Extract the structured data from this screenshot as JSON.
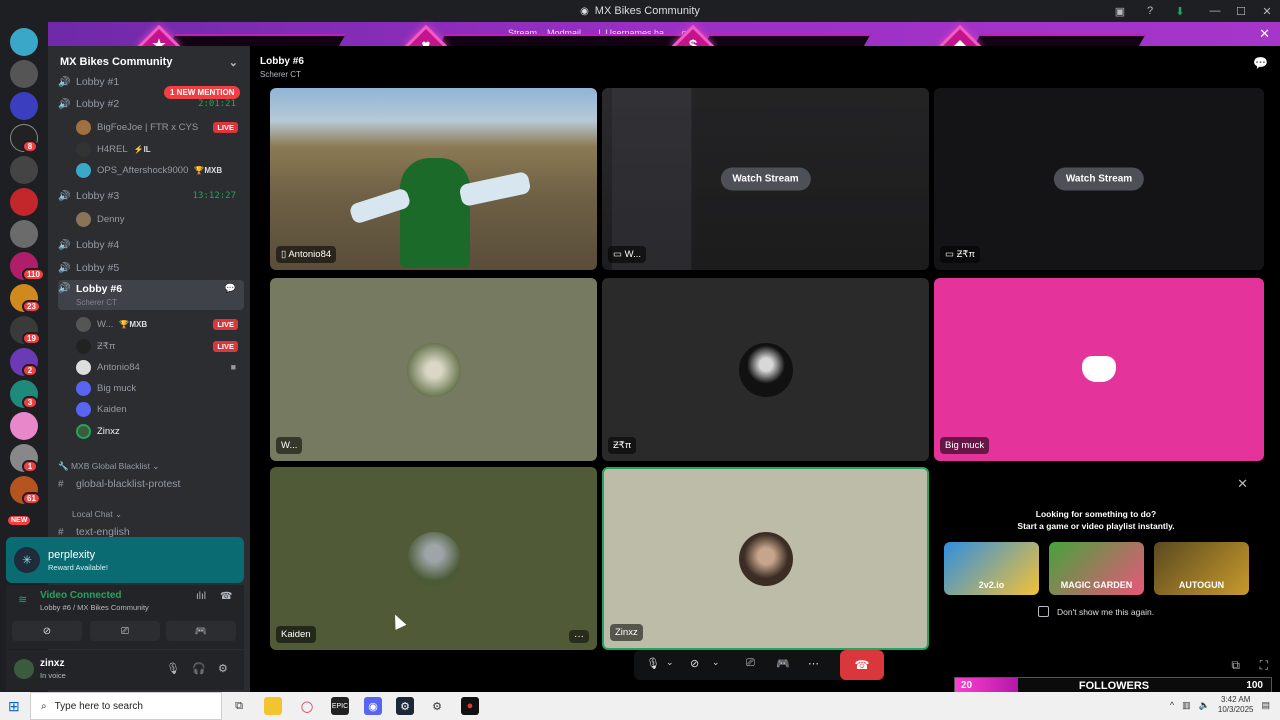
{
  "window": {
    "title": "MX Bikes Community",
    "minimize": "—",
    "maximize": "☐",
    "close": "✕"
  },
  "banner": {
    "text": "Stream... Modmail... ...l. Usernames ha... ...ged.",
    "close": "✕"
  },
  "overlay_symbols": [
    "★",
    "♥",
    "$",
    "◆"
  ],
  "sidebar": {
    "server_name": "MX Bikes Community",
    "mention_badge": "1 NEW MENTION",
    "channels": [
      {
        "name": "Lobby #1",
        "time": ""
      },
      {
        "name": "Lobby #2",
        "time": "2:01:21"
      },
      {
        "name": "Lobby #3",
        "time": "13:12:27"
      },
      {
        "name": "Lobby #4",
        "time": ""
      },
      {
        "name": "Lobby #5",
        "time": ""
      },
      {
        "name": "Lobby #6",
        "time": "",
        "subtitle": "Scherer CT"
      }
    ],
    "lobby2_users": [
      {
        "name": "BigFoeJoe | FTR x CYS",
        "tag": "",
        "live": "LIVE"
      },
      {
        "name": "H4REL",
        "tag": "⚡IL",
        "live": ""
      },
      {
        "name": "OPS_Aftershock9000",
        "tag": "🏆MXB",
        "live": ""
      }
    ],
    "lobby3_users": [
      {
        "name": "Denny"
      }
    ],
    "lobby6_users": [
      {
        "name": "W...",
        "tag": "🏆MXB",
        "live": "LIVE"
      },
      {
        "name": "Ƶ₹π",
        "tag": "",
        "live": "LIVE"
      },
      {
        "name": "Antonio84",
        "tag": "",
        "live": ""
      },
      {
        "name": "Big muck",
        "tag": "",
        "live": ""
      },
      {
        "name": "Kaiden",
        "tag": "",
        "live": ""
      },
      {
        "name": "Zinxz",
        "tag": "",
        "live": ""
      }
    ],
    "categories": [
      {
        "label": "🔧 MXB Global Blacklist ⌄"
      },
      {
        "label": "Local Chat ⌄"
      }
    ],
    "text_channels": [
      "global-blacklist-protest",
      "text-english"
    ],
    "perplexity": {
      "name": "perplexity",
      "sub": "Reward Available!"
    },
    "voice": {
      "status": "Video Connected",
      "location": "Lobby #6 / MX Bikes Community"
    },
    "me": {
      "name": "zinxz",
      "status": "In voice"
    }
  },
  "rail": {
    "badges": [
      "8",
      "110",
      "23",
      "19",
      "2",
      "3",
      "1",
      "61"
    ],
    "new_label": "NEW"
  },
  "main": {
    "channel": "Lobby #6",
    "subtitle": "Scherer CT",
    "tiles": [
      {
        "label": "Antonio84"
      },
      {
        "label": "W...",
        "button": "Watch Stream"
      },
      {
        "label": "Ƶ₹π",
        "button": "Watch Stream"
      },
      {
        "label": "W..."
      },
      {
        "label": "Ƶ₹π"
      },
      {
        "label": "Big muck"
      },
      {
        "label": "Kaiden"
      },
      {
        "label": "Zinxz"
      }
    ],
    "more_button": "···",
    "promo": {
      "line1": "Looking for something to do?",
      "line2": "Start a game or video playlist instantly.",
      "games": [
        "2v2.io",
        "MAGIC GARDEN",
        "AUTOGUN"
      ],
      "checkbox": "Don't show me this again."
    }
  },
  "followers": {
    "current": "20",
    "label": "FOLLOWERS",
    "goal": "100",
    "progress": 0.2
  },
  "taskbar": {
    "search": "Type here to search",
    "time": "3:42 AM",
    "date": "10/3/2025"
  }
}
